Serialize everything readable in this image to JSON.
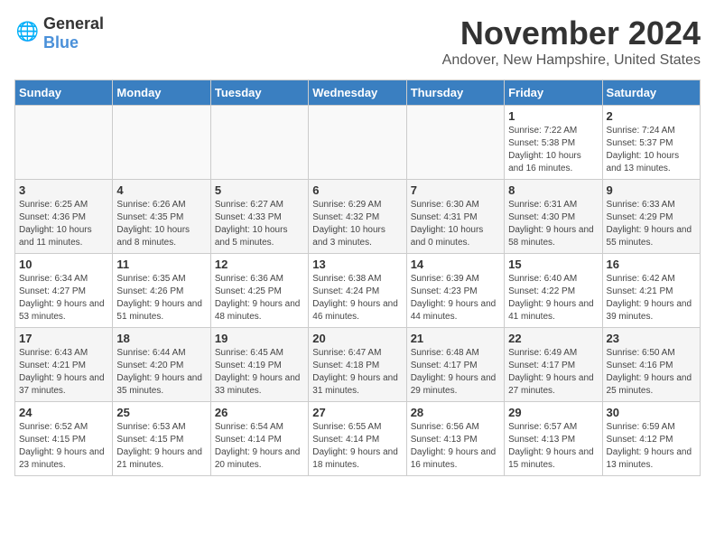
{
  "logo": {
    "text1": "General",
    "text2": "Blue"
  },
  "title": "November 2024",
  "location": "Andover, New Hampshire, United States",
  "weekdays": [
    "Sunday",
    "Monday",
    "Tuesday",
    "Wednesday",
    "Thursday",
    "Friday",
    "Saturday"
  ],
  "weeks": [
    [
      {
        "day": "",
        "info": ""
      },
      {
        "day": "",
        "info": ""
      },
      {
        "day": "",
        "info": ""
      },
      {
        "day": "",
        "info": ""
      },
      {
        "day": "",
        "info": ""
      },
      {
        "day": "1",
        "info": "Sunrise: 7:22 AM\nSunset: 5:38 PM\nDaylight: 10 hours and 16 minutes."
      },
      {
        "day": "2",
        "info": "Sunrise: 7:24 AM\nSunset: 5:37 PM\nDaylight: 10 hours and 13 minutes."
      }
    ],
    [
      {
        "day": "3",
        "info": "Sunrise: 6:25 AM\nSunset: 4:36 PM\nDaylight: 10 hours and 11 minutes."
      },
      {
        "day": "4",
        "info": "Sunrise: 6:26 AM\nSunset: 4:35 PM\nDaylight: 10 hours and 8 minutes."
      },
      {
        "day": "5",
        "info": "Sunrise: 6:27 AM\nSunset: 4:33 PM\nDaylight: 10 hours and 5 minutes."
      },
      {
        "day": "6",
        "info": "Sunrise: 6:29 AM\nSunset: 4:32 PM\nDaylight: 10 hours and 3 minutes."
      },
      {
        "day": "7",
        "info": "Sunrise: 6:30 AM\nSunset: 4:31 PM\nDaylight: 10 hours and 0 minutes."
      },
      {
        "day": "8",
        "info": "Sunrise: 6:31 AM\nSunset: 4:30 PM\nDaylight: 9 hours and 58 minutes."
      },
      {
        "day": "9",
        "info": "Sunrise: 6:33 AM\nSunset: 4:29 PM\nDaylight: 9 hours and 55 minutes."
      }
    ],
    [
      {
        "day": "10",
        "info": "Sunrise: 6:34 AM\nSunset: 4:27 PM\nDaylight: 9 hours and 53 minutes."
      },
      {
        "day": "11",
        "info": "Sunrise: 6:35 AM\nSunset: 4:26 PM\nDaylight: 9 hours and 51 minutes."
      },
      {
        "day": "12",
        "info": "Sunrise: 6:36 AM\nSunset: 4:25 PM\nDaylight: 9 hours and 48 minutes."
      },
      {
        "day": "13",
        "info": "Sunrise: 6:38 AM\nSunset: 4:24 PM\nDaylight: 9 hours and 46 minutes."
      },
      {
        "day": "14",
        "info": "Sunrise: 6:39 AM\nSunset: 4:23 PM\nDaylight: 9 hours and 44 minutes."
      },
      {
        "day": "15",
        "info": "Sunrise: 6:40 AM\nSunset: 4:22 PM\nDaylight: 9 hours and 41 minutes."
      },
      {
        "day": "16",
        "info": "Sunrise: 6:42 AM\nSunset: 4:21 PM\nDaylight: 9 hours and 39 minutes."
      }
    ],
    [
      {
        "day": "17",
        "info": "Sunrise: 6:43 AM\nSunset: 4:21 PM\nDaylight: 9 hours and 37 minutes."
      },
      {
        "day": "18",
        "info": "Sunrise: 6:44 AM\nSunset: 4:20 PM\nDaylight: 9 hours and 35 minutes."
      },
      {
        "day": "19",
        "info": "Sunrise: 6:45 AM\nSunset: 4:19 PM\nDaylight: 9 hours and 33 minutes."
      },
      {
        "day": "20",
        "info": "Sunrise: 6:47 AM\nSunset: 4:18 PM\nDaylight: 9 hours and 31 minutes."
      },
      {
        "day": "21",
        "info": "Sunrise: 6:48 AM\nSunset: 4:17 PM\nDaylight: 9 hours and 29 minutes."
      },
      {
        "day": "22",
        "info": "Sunrise: 6:49 AM\nSunset: 4:17 PM\nDaylight: 9 hours and 27 minutes."
      },
      {
        "day": "23",
        "info": "Sunrise: 6:50 AM\nSunset: 4:16 PM\nDaylight: 9 hours and 25 minutes."
      }
    ],
    [
      {
        "day": "24",
        "info": "Sunrise: 6:52 AM\nSunset: 4:15 PM\nDaylight: 9 hours and 23 minutes."
      },
      {
        "day": "25",
        "info": "Sunrise: 6:53 AM\nSunset: 4:15 PM\nDaylight: 9 hours and 21 minutes."
      },
      {
        "day": "26",
        "info": "Sunrise: 6:54 AM\nSunset: 4:14 PM\nDaylight: 9 hours and 20 minutes."
      },
      {
        "day": "27",
        "info": "Sunrise: 6:55 AM\nSunset: 4:14 PM\nDaylight: 9 hours and 18 minutes."
      },
      {
        "day": "28",
        "info": "Sunrise: 6:56 AM\nSunset: 4:13 PM\nDaylight: 9 hours and 16 minutes."
      },
      {
        "day": "29",
        "info": "Sunrise: 6:57 AM\nSunset: 4:13 PM\nDaylight: 9 hours and 15 minutes."
      },
      {
        "day": "30",
        "info": "Sunrise: 6:59 AM\nSunset: 4:12 PM\nDaylight: 9 hours and 13 minutes."
      }
    ]
  ]
}
